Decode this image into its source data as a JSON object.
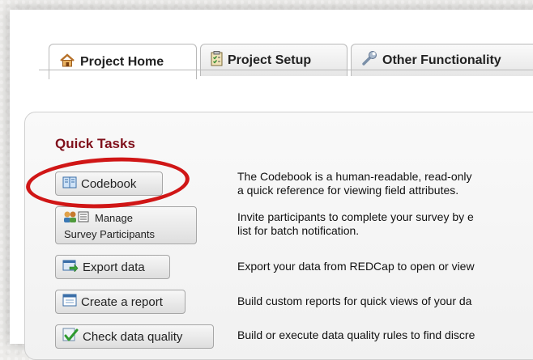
{
  "tabs": [
    {
      "label": "Project Home",
      "icon": "house-icon"
    },
    {
      "label": "Project Setup",
      "icon": "clipboard-checklist-icon"
    },
    {
      "label": "Other Functionality",
      "icon": "wrench-icon"
    }
  ],
  "quick_tasks": {
    "title": "Quick Tasks",
    "items": [
      {
        "button": "Codebook",
        "icon": "book-icon",
        "desc_line1": "The Codebook is a human-readable, read-only",
        "desc_line2": "a quick reference for viewing field attributes."
      },
      {
        "button_line1": "Manage",
        "button_line2": "Survey Participants",
        "icon": "people-list-icon",
        "desc_line1": "Invite participants to complete your survey by e",
        "desc_line2": "list for batch notification."
      },
      {
        "button": "Export data",
        "icon": "export-arrow-icon",
        "desc_line1": "Export your data from REDCap to open or view"
      },
      {
        "button": "Create a report",
        "icon": "report-window-icon",
        "desc_line1": "Build custom reports for quick views of your da"
      },
      {
        "button": "Check data quality",
        "icon": "checkmark-icon",
        "desc_line1": "Build or execute data quality rules to find discre"
      }
    ]
  },
  "annotation_color": "#d01616"
}
